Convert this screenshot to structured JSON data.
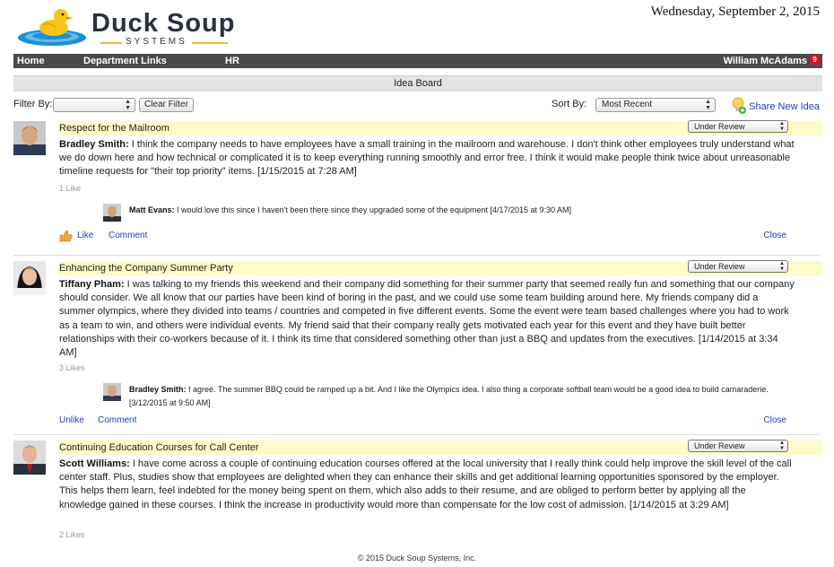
{
  "brand": {
    "name": "Duck Soup",
    "sub": "SYSTEMS"
  },
  "date": "Wednesday, September 2, 2015",
  "nav": {
    "home": "Home",
    "department_links": "Department Links",
    "hr": "HR",
    "user": "William McAdams",
    "notifications": "9"
  },
  "page_title": "Idea Board",
  "filter": {
    "label": "Filter By:",
    "value": "",
    "clear": "Clear Filter"
  },
  "sort": {
    "label": "Sort By:",
    "value": "Most Recent"
  },
  "share_label": "Share New Idea",
  "posts": [
    {
      "title": "Respect for the Mailroom",
      "status": "Under Review",
      "author": "Bradley Smith:",
      "text": "I think the company needs to have employees have a small training in the mailroom and warehouse.  I don't think other employees truly understand what we do down here and how technical or complicated it is to keep everything running smoothly and error free.  I think it would make people think twice about unreasonable timeline requests for \"their top priority\" items. [1/15/2015 at 7:28 AM]",
      "likes": "1 Like",
      "comment": {
        "author": "Matt Evans:",
        "text": "I would love this since I haven't been there since they upgraded some of the equipment [4/17/2015 at 9:30 AM]"
      },
      "like_label": "Like",
      "comment_label": "Comment",
      "close_label": "Close"
    },
    {
      "title": "Enhancing the Company Summer Party",
      "status": "Under Review",
      "author": "Tiffany Pham:",
      "text": "I was talking to my friends this weekend and their company did something for their summer party that seemed really fun and something that our company should consider.  We all know that our parties have been kind of boring in the past, and we could use some team building around here.  My friends company did a summer olympics, where they divided into teams / countries and competed in five different events.  Some the event were team based challenges where you had to work as a team to win, and others were individual events.  My friend said that their company really gets motivated each year for this event and they have built better relationships with their co-workers because of it.  I think its time that considered something other than just a BBQ and updates from the executives. [1/14/2015 at 3:34 AM]",
      "likes": "3 Likes",
      "comment": {
        "author": "Bradley Smith:",
        "text": "I agree. The summer BBQ could be ramped up a bit. And I like the Olympics idea. I also thing a corporate softball team would be a good idea to build camaraderie. [3/12/2015 at 9:50 AM]"
      },
      "like_label": "Unlike",
      "comment_label": "Comment",
      "close_label": "Close"
    },
    {
      "title": "Continuing Education Courses for Call Center",
      "status": "Under Review",
      "author": "Scott Williams:",
      "text": "I have come across a couple of continuing education courses offered at the local university that I really think could help improve the skill level of the call center staff.  Plus, studies show that employees are delighted when they can enhance their skills and get additional learning opportunities sponsored by the employer. This helps them learn, feel indebted for the money being spent on them, which also adds to their resume, and are obliged to perform better by applying all the knowledge gained in these courses.  I think the increase in productivity would more than compensate for the low cost of admission. [1/14/2015 at 3:29 AM]",
      "likes": "2 Likes"
    }
  ],
  "footer": "© 2015 Duck Soup Systems, Inc."
}
